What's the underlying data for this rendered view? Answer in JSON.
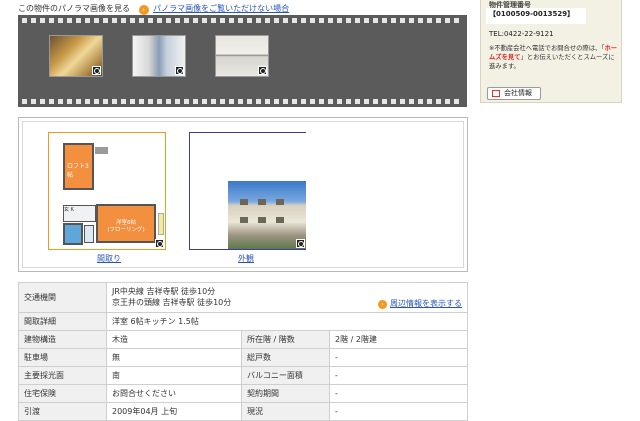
{
  "panorama": {
    "text": "この物件のパノラマ画像を見る",
    "link": "パノラマ画像をご覧いただけない場合",
    "thumbnails": [
      "room-photo-1",
      "room-photo-2",
      "room-photo-3"
    ]
  },
  "side": {
    "mgmt_heading": "物件管理番号",
    "mgmt_number": "【0100509-0013529】",
    "tel": "TEL:0422-22-9121",
    "note_pre": "※不動産会社へ電話でお問合せの際は、「",
    "note_highlight": "ホームズを見て",
    "note_post": "」とお伝えいただくとスムーズに進みます。",
    "company_button": "会社情報"
  },
  "floorplan": {
    "loft_label": "ロフト3帖",
    "main_room_label": "洋室6帖",
    "main_room_sub": "(フローリング)",
    "kitchen_label": "K",
    "entrance_label": "玄",
    "floorplan_link": "間取り",
    "exterior_link": "外観"
  },
  "details": {
    "nearby_link": "周辺情報を表示する",
    "access_label": "交通機関",
    "access_line1": "JR中央線 吉祥寺駅 徒歩10分",
    "access_line2": "京王井の頭線 吉祥寺駅 徒歩10分",
    "layout_label": "間取詳細",
    "layout_value": "洋室 6帖キッチン 1.5帖",
    "rows": [
      {
        "l1": "建物構造",
        "v1": "木造",
        "l2": "所在階 / 階数",
        "v2": "2階 / 2階建"
      },
      {
        "l1": "駐車場",
        "v1": "無",
        "l2": "総戸数",
        "v2": "-"
      },
      {
        "l1": "主要採光面",
        "v1": "南",
        "l2": "バルコニー面積",
        "v2": "-"
      },
      {
        "l1": "住宅保険",
        "v1": "お問合せください",
        "l2": "契約期間",
        "v2": "-"
      },
      {
        "l1": "引渡",
        "v1": "2009年04月 上旬",
        "l2": "現況",
        "v2": "-"
      }
    ]
  }
}
